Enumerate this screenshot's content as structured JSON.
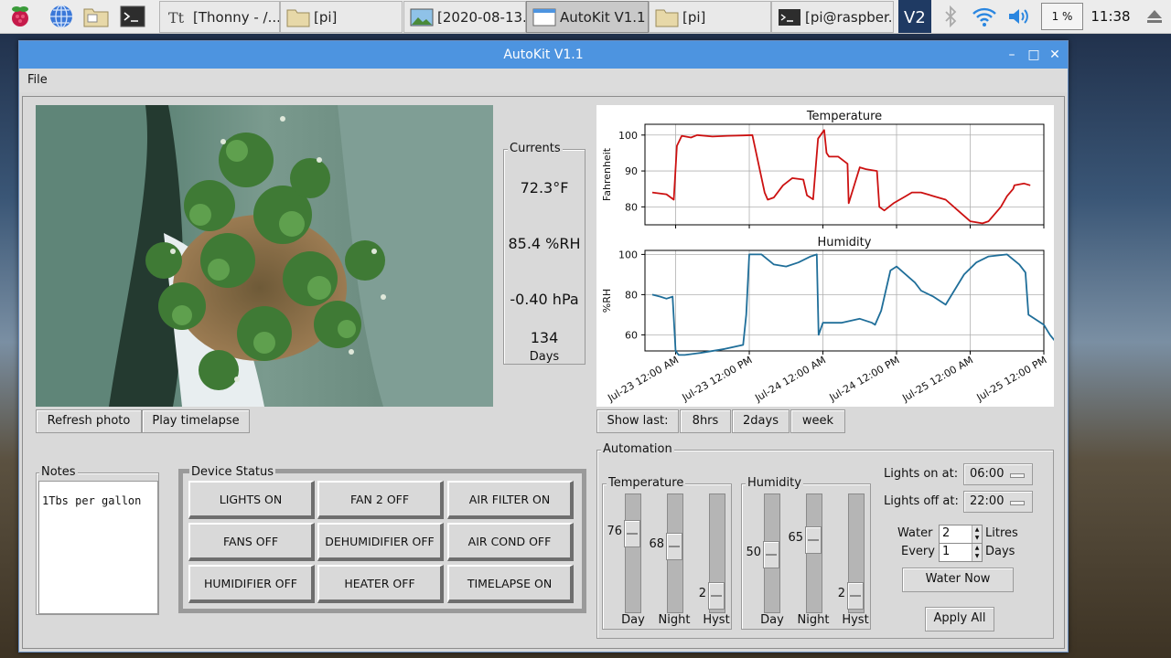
{
  "taskbar": {
    "tasks": [
      "[Thonny - /...",
      "[pi]",
      "[2020-08-13...",
      "AutoKit V1.1",
      "[pi]",
      "[pi@raspber..."
    ],
    "cpu": "1 %",
    "clock": "11:38"
  },
  "window": {
    "title": "AutoKit V1.1",
    "menu_file": "File"
  },
  "photo": {
    "refresh_label": "Refresh photo",
    "timelapse_label": "Play timelapse"
  },
  "currents": {
    "label": "Currents",
    "temperature": "72.3°F",
    "humidity": "85.4 %RH",
    "pressure": "-0.40 hPa",
    "days_value": "134",
    "days_label": "Days"
  },
  "charts": {
    "show_last_label": "Show last:",
    "range_8hrs": "8hrs",
    "range_2days": "2days",
    "range_week": "week",
    "x_tick_labels": [
      "Jul-23 12:00 AM",
      "Jul-23 12:00 PM",
      "Jul-24 12:00 AM",
      "Jul-24 12:00 PM",
      "Jul-25 12:00 AM",
      "Jul-25 12:00 PM"
    ]
  },
  "chart_data": [
    {
      "type": "line",
      "title": "Temperature",
      "ylabel": "Fahrenheit",
      "xlabel": "",
      "x_unit": "hours from Jul-23 12:00 AM",
      "ylim": [
        75,
        103
      ],
      "yticks": [
        80,
        90,
        100
      ],
      "grid": true,
      "color": "#cc1111",
      "x": [
        -3.8,
        -1.5,
        -0.3,
        0.2,
        1,
        2.5,
        3.5,
        6,
        8.5,
        11,
        12.5,
        14.5,
        15,
        16,
        17.5,
        19,
        20.8,
        21.4,
        22.4,
        23.2,
        24.2,
        24.6,
        25,
        26.5,
        28,
        28.2,
        30,
        31,
        32.8,
        33.2,
        34,
        35.5,
        37.5,
        38.5,
        40,
        42,
        44,
        46,
        48,
        50,
        51,
        53,
        54,
        55,
        55.2,
        56.8,
        57.8
      ],
      "values": [
        84,
        83.5,
        82,
        97,
        99.8,
        99.3,
        100,
        99.6,
        99.8,
        99.9,
        100,
        84,
        82,
        82.6,
        86,
        88,
        87.6,
        83.2,
        82.1,
        99,
        101.4,
        95,
        94,
        94,
        92,
        81,
        91,
        90.5,
        90,
        80,
        79,
        81,
        83,
        84,
        84,
        83,
        82,
        79,
        76,
        75.4,
        76,
        80,
        83,
        85,
        86,
        86.5,
        86
      ]
    },
    {
      "type": "line",
      "title": "Humidity",
      "ylabel": "%RH",
      "xlabel": "",
      "x_unit": "hours from Jul-23 12:00 AM",
      "ylim": [
        52,
        102
      ],
      "yticks": [
        60,
        80,
        100
      ],
      "grid": true,
      "color": "#1f6e99",
      "x": [
        -3.8,
        -2.5,
        -1.5,
        -0.5,
        0,
        0.5,
        1.5,
        4,
        8,
        11,
        11.5,
        12,
        12.5,
        14,
        16,
        18,
        20,
        22,
        23,
        23.3,
        24,
        25,
        27,
        30,
        32,
        32.5,
        33.5,
        35,
        36,
        37.5,
        39,
        40,
        42,
        44,
        45,
        47,
        49,
        51,
        54,
        56,
        57,
        57.5,
        58.5,
        60,
        61,
        61.8
      ],
      "values": [
        80,
        79,
        78,
        79,
        52,
        50,
        50,
        51,
        53,
        55,
        70,
        100,
        100,
        100,
        95,
        94,
        96,
        99,
        100,
        60,
        66,
        66,
        66,
        68,
        66,
        65,
        72,
        92,
        94,
        90,
        86,
        82,
        79,
        75,
        80,
        90,
        96,
        99,
        100,
        95,
        91,
        70,
        68,
        65,
        60,
        57
      ]
    }
  ],
  "notes": {
    "label": "Notes",
    "text": "1Tbs per gallon"
  },
  "devices": {
    "label": "Device Status",
    "items": [
      "LIGHTS ON",
      "FAN 2 OFF",
      "AIR FILTER ON",
      "FANS OFF",
      "DEHUMIDIFIER OFF",
      "AIR COND OFF",
      "HUMIDIFIER OFF",
      "HEATER OFF",
      "TIMELAPSE ON"
    ]
  },
  "automation": {
    "label": "Automation",
    "temperature": {
      "label": "Temperature",
      "day": 76,
      "night": 68,
      "hyst": 2,
      "day_fill": 0.72,
      "night_fill": 0.58,
      "hyst_fill": 0.05
    },
    "humidity": {
      "label": "Humidity",
      "day": 50,
      "night": 65,
      "hyst": 2,
      "day_fill": 0.5,
      "night_fill": 0.65,
      "hyst_fill": 0.05
    },
    "slider_labels": {
      "day": "Day",
      "night": "Night",
      "hyst": "Hyst"
    },
    "lights_on_label": "Lights on at:",
    "lights_on_value": "06:00",
    "lights_off_label": "Lights off at:",
    "lights_off_value": "22:00",
    "water_label": "Water",
    "water_value": "2",
    "water_unit": "Litres",
    "every_label": "Every",
    "every_value": "1",
    "every_unit": "Days",
    "water_now_label": "Water Now",
    "apply_label": "Apply All"
  }
}
